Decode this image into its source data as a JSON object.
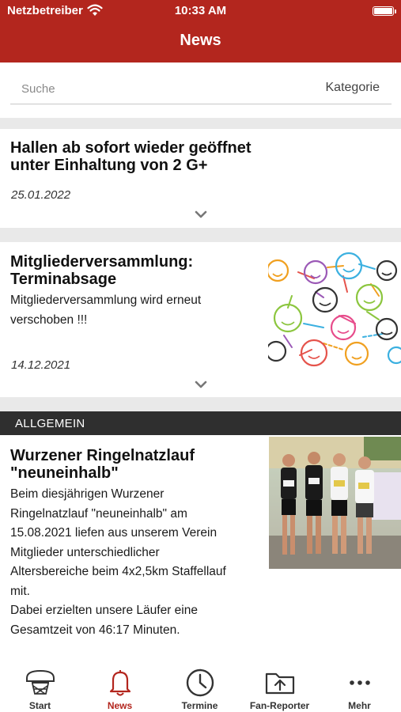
{
  "status_bar": {
    "carrier": "Netzbetreiber",
    "time": "10:33 AM"
  },
  "header": {
    "title": "News"
  },
  "search": {
    "placeholder": "Suche",
    "category_label": "Kategorie"
  },
  "articles": [
    {
      "title_lines": [
        "Hallen ab sofort wieder geöffnet",
        "unter Einhaltung von 2 G+"
      ],
      "date": "25.01.2022"
    },
    {
      "title_lines": [
        "Mitgliederversammlung:",
        "Terminabsage"
      ],
      "text_lines": [
        "Mitgliederversammlung wird erneut",
        "verschoben !!!"
      ],
      "date": "14.12.2021",
      "image": "smiley-network-image"
    },
    {
      "category": "ALLGEMEIN",
      "title_lines": [
        "Wurzener Ringelnatzlauf",
        "\"neuneinhalb\""
      ],
      "text_lines": [
        "Beim diesjährigen Wurzener",
        "Ringelnatzlauf \"neuneinhalb\" am",
        "15.08.2021 liefen aus unserem Verein",
        "Mitglieder unterschiedlicher",
        "Altersbereiche beim 4x2,5km Staffellauf",
        "mit.",
        "Dabei erzielten unsere Läufer eine",
        "Gesamtzeit von 46:17 Minuten."
      ],
      "image": "runners-photo"
    }
  ],
  "tabbar": {
    "items": [
      {
        "label": "Start",
        "icon": "basketball-hoop-icon"
      },
      {
        "label": "News",
        "icon": "bell-icon",
        "active": true
      },
      {
        "label": "Termine",
        "icon": "clock-icon"
      },
      {
        "label": "Fan-Reporter",
        "icon": "folder-upload-icon"
      },
      {
        "label": "Mehr",
        "icon": "more-dots-icon"
      }
    ]
  },
  "colors": {
    "brand": "#b3261e",
    "category_band": "#2f2f2f",
    "separator": "#e9e9e9"
  }
}
